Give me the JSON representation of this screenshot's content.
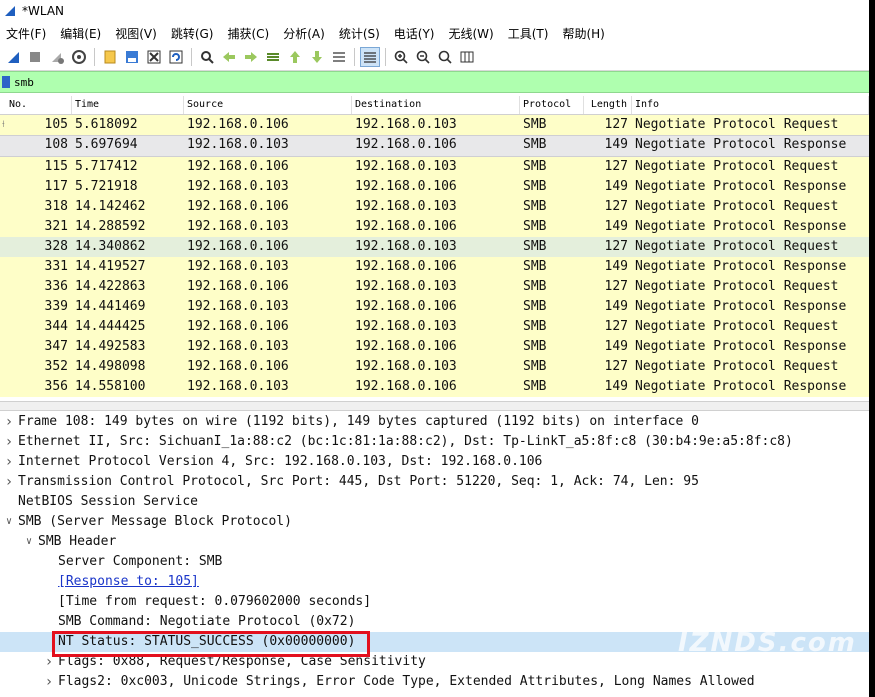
{
  "window": {
    "title": "*WLAN"
  },
  "menu": [
    "文件(F)",
    "编辑(E)",
    "视图(V)",
    "跳转(G)",
    "捕获(C)",
    "分析(A)",
    "统计(S)",
    "电话(Y)",
    "无线(W)",
    "工具(T)",
    "帮助(H)"
  ],
  "toolbar": {
    "icons": [
      "start-capture-icon",
      "stop-capture-icon",
      "restart-capture-icon",
      "capture-options-icon",
      "sep",
      "open-file-icon",
      "save-file-icon",
      "close-file-icon",
      "reload-file-icon",
      "sep",
      "find-packet-icon",
      "go-back-icon",
      "go-forward-icon",
      "go-to-packet-icon",
      "go-first-icon",
      "go-last-icon",
      "auto-scroll-icon",
      "sep",
      "colorize-icon",
      "sep",
      "zoom-in-icon",
      "zoom-out-icon",
      "zoom-normal-icon",
      "resize-columns-icon"
    ]
  },
  "filter": {
    "value": "smb"
  },
  "packet_list": {
    "columns": [
      "No.",
      "Time",
      "Source",
      "Destination",
      "Protocol",
      "Length",
      "Info"
    ],
    "rows": [
      [
        "105",
        "5.618092",
        "192.168.0.106",
        "192.168.0.103",
        "SMB",
        "127",
        "Negotiate Protocol Request"
      ],
      [
        "108",
        "5.697694",
        "192.168.0.103",
        "192.168.0.106",
        "SMB",
        "149",
        "Negotiate Protocol Response"
      ],
      [
        "115",
        "5.717412",
        "192.168.0.106",
        "192.168.0.103",
        "SMB",
        "127",
        "Negotiate Protocol Request"
      ],
      [
        "117",
        "5.721918",
        "192.168.0.103",
        "192.168.0.106",
        "SMB",
        "149",
        "Negotiate Protocol Response"
      ],
      [
        "318",
        "14.142462",
        "192.168.0.106",
        "192.168.0.103",
        "SMB",
        "127",
        "Negotiate Protocol Request"
      ],
      [
        "321",
        "14.288592",
        "192.168.0.103",
        "192.168.0.106",
        "SMB",
        "149",
        "Negotiate Protocol Response"
      ],
      [
        "328",
        "14.340862",
        "192.168.0.106",
        "192.168.0.103",
        "SMB",
        "127",
        "Negotiate Protocol Request"
      ],
      [
        "331",
        "14.419527",
        "192.168.0.103",
        "192.168.0.106",
        "SMB",
        "149",
        "Negotiate Protocol Response"
      ],
      [
        "336",
        "14.422863",
        "192.168.0.106",
        "192.168.0.103",
        "SMB",
        "127",
        "Negotiate Protocol Request"
      ],
      [
        "339",
        "14.441469",
        "192.168.0.103",
        "192.168.0.106",
        "SMB",
        "149",
        "Negotiate Protocol Response"
      ],
      [
        "344",
        "14.444425",
        "192.168.0.106",
        "192.168.0.103",
        "SMB",
        "127",
        "Negotiate Protocol Request"
      ],
      [
        "347",
        "14.492583",
        "192.168.0.103",
        "192.168.0.106",
        "SMB",
        "149",
        "Negotiate Protocol Response"
      ],
      [
        "352",
        "14.498098",
        "192.168.0.106",
        "192.168.0.103",
        "SMB",
        "127",
        "Negotiate Protocol Request"
      ],
      [
        "356",
        "14.558100",
        "192.168.0.103",
        "192.168.0.106",
        "SMB",
        "149",
        "Negotiate Protocol Response"
      ]
    ],
    "selected_index": 1,
    "alt_index": 6
  },
  "details": [
    {
      "level": 0,
      "expand": "collapsed",
      "text": "Frame 108: 149 bytes on wire (1192 bits), 149 bytes captured (1192 bits) on interface 0"
    },
    {
      "level": 0,
      "expand": "collapsed",
      "text": "Ethernet II, Src: SichuanI_1a:88:c2 (bc:1c:81:1a:88:c2), Dst: Tp-LinkT_a5:8f:c8 (30:b4:9e:a5:8f:c8)"
    },
    {
      "level": 0,
      "expand": "collapsed",
      "text": "Internet Protocol Version 4, Src: 192.168.0.103, Dst: 192.168.0.106"
    },
    {
      "level": 0,
      "expand": "collapsed",
      "text": "Transmission Control Protocol, Src Port: 445, Dst Port: 51220, Seq: 1, Ack: 74, Len: 95"
    },
    {
      "level": 0,
      "expand": "none",
      "text": "NetBIOS Session Service"
    },
    {
      "level": 0,
      "expand": "expanded",
      "text": "SMB (Server Message Block Protocol)"
    },
    {
      "level": 1,
      "expand": "expanded",
      "text": "SMB Header"
    },
    {
      "level": 2,
      "expand": "none",
      "text": "Server Component: SMB"
    },
    {
      "level": 2,
      "expand": "none",
      "text": "[Response to: 105]",
      "link": true
    },
    {
      "level": 2,
      "expand": "none",
      "text": "[Time from request: 0.079602000 seconds]"
    },
    {
      "level": 2,
      "expand": "none",
      "text": "SMB Command: Negotiate Protocol (0x72)"
    },
    {
      "level": 2,
      "expand": "none",
      "text": "NT Status: STATUS_SUCCESS (0x00000000)",
      "highlight": true
    },
    {
      "level": 2,
      "expand": "collapsed",
      "text": "Flags: 0x88, Request/Response, Case Sensitivity"
    },
    {
      "level": 2,
      "expand": "collapsed",
      "text": "Flags2: 0xc003, Unicode Strings, Error Code Type, Extended Attributes, Long Names Allowed"
    }
  ],
  "watermark": "IZNDS.com",
  "colors": {
    "row_yellow": "#fefec8",
    "row_selected": "#e8e8ea",
    "filter_green": "#afffaf",
    "highlight_blue": "#cce4f7",
    "red_box": "#e3101e"
  }
}
